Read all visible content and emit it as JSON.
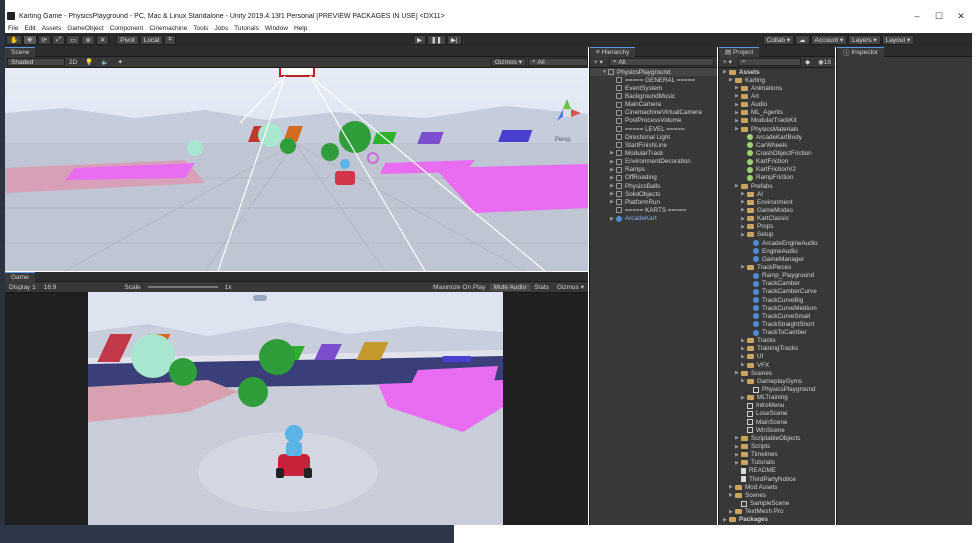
{
  "window": {
    "title": "Karting Game - PhysicsPlayground - PC, Mac & Linux Standalone - Unity 2019.4.13f1 Personal [PREVIEW PACKAGES IN USE] <DX11>",
    "minimize": "–",
    "maximize": "☐",
    "close": "✕"
  },
  "menu": [
    "File",
    "Edit",
    "Assets",
    "GameObject",
    "Component",
    "Cinemachine",
    "Tools",
    "Jobs",
    "Tutorials",
    "Window",
    "Help"
  ],
  "toolbar": {
    "pivot": "Pivot",
    "local": "Local",
    "collab": "Collab ▾",
    "account": "Account ▾",
    "layers": "Layers ▾",
    "layout": "Layout ▾"
  },
  "scene": {
    "tab": "Scene",
    "shading": "Shaded",
    "mode_2d": "2D",
    "gizmos": "Gizmos ▾",
    "search": "All",
    "persp": "Persp"
  },
  "game": {
    "tab": "Game",
    "display": "Display 1",
    "aspect": "16:9",
    "scale_label": "Scale",
    "scale_value": "1x",
    "maximize": "Maximize On Play",
    "mute": "Mute Audio",
    "stats": "Stats",
    "gizmos": "Gizmos ▾"
  },
  "hierarchy": {
    "tab": "Hierarchy",
    "search": "All",
    "root": "PhysicsPlayground",
    "items": [
      "===== GENERAL =====",
      "EventSystem",
      "BackgroundMusic",
      "MainCamera",
      "CinemachineVirtualCamera",
      "PostProcessVolume",
      "===== LEVEL =====",
      "Directional Light",
      "StartFinishLine",
      "ModularTrack",
      "EnvironmentDecoration",
      "Ramps",
      "OffRoading",
      "PhysicsBalls",
      "SolidObjects",
      "PlatformRun",
      "===== KARTS =====",
      "ArcadeKart"
    ]
  },
  "project": {
    "tab": "Project",
    "count": "18",
    "items": [
      {
        "label": "Assets",
        "indent": 0,
        "type": "folder",
        "bold": true
      },
      {
        "label": "Karting",
        "indent": 1,
        "type": "folder"
      },
      {
        "label": "Animations",
        "indent": 2,
        "type": "folder"
      },
      {
        "label": "Art",
        "indent": 2,
        "type": "folder"
      },
      {
        "label": "Audio",
        "indent": 2,
        "type": "folder"
      },
      {
        "label": "ML_Agents",
        "indent": 2,
        "type": "folder"
      },
      {
        "label": "ModularTrackKit",
        "indent": 2,
        "type": "folder"
      },
      {
        "label": "PhysicsMaterials",
        "indent": 2,
        "type": "folder"
      },
      {
        "label": "ArcadeKartBody",
        "indent": 3,
        "type": "mat"
      },
      {
        "label": "CarWheels",
        "indent": 3,
        "type": "mat"
      },
      {
        "label": "CrashObjectFriction",
        "indent": 3,
        "type": "mat"
      },
      {
        "label": "KartFriction",
        "indent": 3,
        "type": "mat"
      },
      {
        "label": "KartFrictionV2",
        "indent": 3,
        "type": "mat"
      },
      {
        "label": "RampFriction",
        "indent": 3,
        "type": "mat"
      },
      {
        "label": "Prefabs",
        "indent": 2,
        "type": "folder"
      },
      {
        "label": "AI",
        "indent": 3,
        "type": "folder"
      },
      {
        "label": "Environment",
        "indent": 3,
        "type": "folder"
      },
      {
        "label": "GameModes",
        "indent": 3,
        "type": "folder"
      },
      {
        "label": "KartClassic",
        "indent": 3,
        "type": "folder"
      },
      {
        "label": "Props",
        "indent": 3,
        "type": "folder"
      },
      {
        "label": "Setup",
        "indent": 3,
        "type": "folder"
      },
      {
        "label": "ArcadeEngineAudio",
        "indent": 4,
        "type": "prefab"
      },
      {
        "label": "EngineAudio",
        "indent": 4,
        "type": "prefab"
      },
      {
        "label": "GameManager",
        "indent": 4,
        "type": "prefab"
      },
      {
        "label": "TrackPieces",
        "indent": 3,
        "type": "folder"
      },
      {
        "label": "Ramp_Playground",
        "indent": 4,
        "type": "prefab"
      },
      {
        "label": "TrackCamber",
        "indent": 4,
        "type": "prefab"
      },
      {
        "label": "TrackCamberCurve",
        "indent": 4,
        "type": "prefab"
      },
      {
        "label": "TrackCurveBig",
        "indent": 4,
        "type": "prefab"
      },
      {
        "label": "TrackCurveMedium",
        "indent": 4,
        "type": "prefab"
      },
      {
        "label": "TrackCurveSmall",
        "indent": 4,
        "type": "prefab"
      },
      {
        "label": "TrackStraightShort",
        "indent": 4,
        "type": "prefab"
      },
      {
        "label": "TrackToCamber",
        "indent": 4,
        "type": "prefab"
      },
      {
        "label": "Tracks",
        "indent": 3,
        "type": "folder"
      },
      {
        "label": "TrainingTracks",
        "indent": 3,
        "type": "folder"
      },
      {
        "label": "UI",
        "indent": 3,
        "type": "folder"
      },
      {
        "label": "VFX",
        "indent": 3,
        "type": "folder"
      },
      {
        "label": "Scenes",
        "indent": 2,
        "type": "folder"
      },
      {
        "label": "GameplayGyms",
        "indent": 3,
        "type": "folder"
      },
      {
        "label": "PhysicsPlayground",
        "indent": 4,
        "type": "scene"
      },
      {
        "label": "MLTraining",
        "indent": 3,
        "type": "folder"
      },
      {
        "label": "IntroMenu",
        "indent": 3,
        "type": "scene"
      },
      {
        "label": "LoseScene",
        "indent": 3,
        "type": "scene"
      },
      {
        "label": "MainScene",
        "indent": 3,
        "type": "scene"
      },
      {
        "label": "WinScene",
        "indent": 3,
        "type": "scene"
      },
      {
        "label": "ScriptableObjects",
        "indent": 2,
        "type": "folder"
      },
      {
        "label": "Scripts",
        "indent": 2,
        "type": "folder"
      },
      {
        "label": "Timelines",
        "indent": 2,
        "type": "folder"
      },
      {
        "label": "Tutorials",
        "indent": 2,
        "type": "folder"
      },
      {
        "label": "README",
        "indent": 2,
        "type": "file"
      },
      {
        "label": "ThirdPartyNotice",
        "indent": 2,
        "type": "file"
      },
      {
        "label": "Mod Assets",
        "indent": 1,
        "type": "folder"
      },
      {
        "label": "Scenes",
        "indent": 1,
        "type": "folder"
      },
      {
        "label": "SampleScene",
        "indent": 2,
        "type": "scene"
      },
      {
        "label": "TextMesh Pro",
        "indent": 1,
        "type": "folder"
      },
      {
        "label": "Packages",
        "indent": 0,
        "type": "folder",
        "bold": true
      }
    ]
  },
  "inspector": {
    "tab": "Inspector"
  },
  "colors": {
    "editor_bg": "#383838",
    "selection": "#3e5f96",
    "sky": "#dfe6f2",
    "ground": "#b9bfd0",
    "green_ball": "#2f9d3a",
    "mint_ball": "#a8e6cf",
    "magenta_ramp": "#e86df0"
  }
}
